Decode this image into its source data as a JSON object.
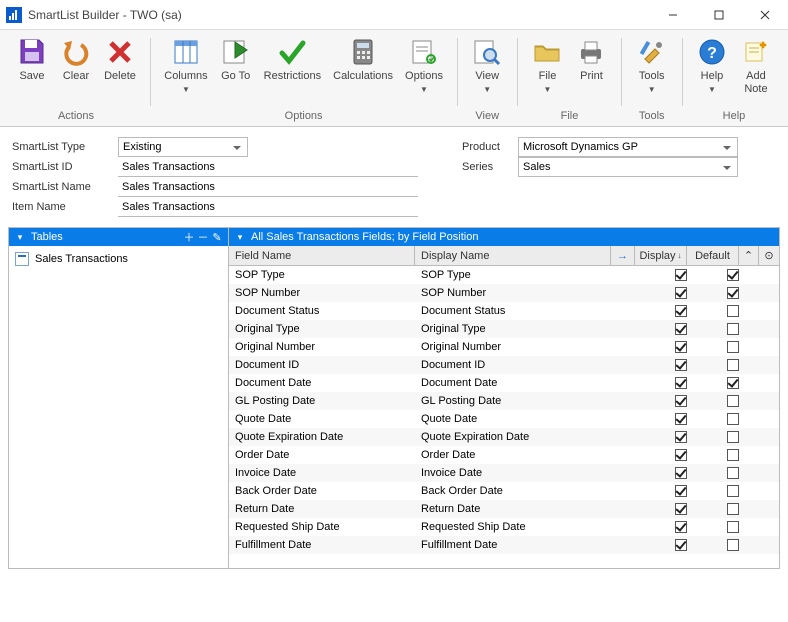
{
  "window": {
    "title": "SmartList Builder  -  TWO (sa)"
  },
  "ribbon": {
    "actions": {
      "label": "Actions",
      "save": "Save",
      "clear": "Clear",
      "delete": "Delete"
    },
    "options_group": {
      "label": "Options",
      "columns": "Columns",
      "goto": "Go To",
      "restrictions": "Restrictions",
      "calculations": "Calculations",
      "options": "Options"
    },
    "view_group": {
      "label": "View",
      "view": "View"
    },
    "file_group": {
      "label": "File",
      "file": "File",
      "print": "Print"
    },
    "tools_group": {
      "label": "Tools",
      "tools": "Tools"
    },
    "help_group": {
      "label": "Help",
      "help": "Help",
      "add_note": "Add\nNote"
    }
  },
  "form": {
    "smartlist_type_label": "SmartList Type",
    "smartlist_type_value": "Existing",
    "smartlist_id_label": "SmartList ID",
    "smartlist_id_value": "Sales Transactions",
    "smartlist_name_label": "SmartList Name",
    "smartlist_name_value": "Sales Transactions",
    "item_name_label": "Item Name",
    "item_name_value": "Sales Transactions",
    "product_label": "Product",
    "product_value": "Microsoft Dynamics GP",
    "series_label": "Series",
    "series_value": "Sales"
  },
  "left_pane": {
    "header": "Tables",
    "item": "Sales Transactions"
  },
  "right_pane": {
    "header": "All Sales Transactions Fields; by Field Position",
    "col_field_name": "Field Name",
    "col_display_name": "Display Name",
    "col_display": "Display",
    "col_default": "Default"
  },
  "rows": [
    {
      "fn": "SOP Type",
      "dn": "SOP Type",
      "disp": true,
      "def": true
    },
    {
      "fn": "SOP Number",
      "dn": "SOP Number",
      "disp": true,
      "def": true
    },
    {
      "fn": "Document Status",
      "dn": "Document Status",
      "disp": true,
      "def": false
    },
    {
      "fn": "Original Type",
      "dn": "Original Type",
      "disp": true,
      "def": false
    },
    {
      "fn": "Original Number",
      "dn": "Original Number",
      "disp": true,
      "def": false
    },
    {
      "fn": "Document ID",
      "dn": "Document ID",
      "disp": true,
      "def": false
    },
    {
      "fn": "Document Date",
      "dn": "Document Date",
      "disp": true,
      "def": true
    },
    {
      "fn": "GL Posting Date",
      "dn": "GL Posting Date",
      "disp": true,
      "def": false
    },
    {
      "fn": "Quote Date",
      "dn": "Quote Date",
      "disp": true,
      "def": false
    },
    {
      "fn": "Quote Expiration Date",
      "dn": "Quote Expiration Date",
      "disp": true,
      "def": false
    },
    {
      "fn": "Order Date",
      "dn": "Order Date",
      "disp": true,
      "def": false
    },
    {
      "fn": "Invoice Date",
      "dn": "Invoice Date",
      "disp": true,
      "def": false
    },
    {
      "fn": "Back Order Date",
      "dn": "Back Order Date",
      "disp": true,
      "def": false
    },
    {
      "fn": "Return Date",
      "dn": "Return Date",
      "disp": true,
      "def": false
    },
    {
      "fn": "Requested Ship Date",
      "dn": "Requested Ship Date",
      "disp": true,
      "def": false
    },
    {
      "fn": "Fulfillment Date",
      "dn": "Fulfillment Date",
      "disp": true,
      "def": false
    }
  ]
}
